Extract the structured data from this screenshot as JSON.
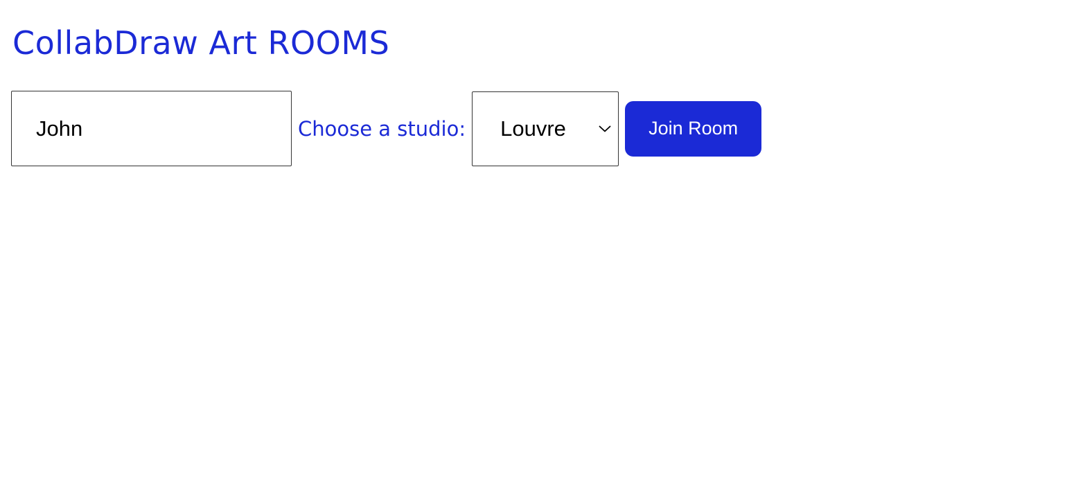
{
  "header": {
    "title": "CollabDraw Art ROOMS"
  },
  "form": {
    "name_value": "John",
    "studio_label": "Choose a studio:",
    "studio_selected": "Louvre",
    "join_label": "Join Room"
  },
  "icons": {
    "select_arrow": "chevron-down-icon"
  },
  "colors": {
    "accent": "#1b2ad6",
    "button_text": "#ffffff",
    "input_border": "#333333"
  }
}
